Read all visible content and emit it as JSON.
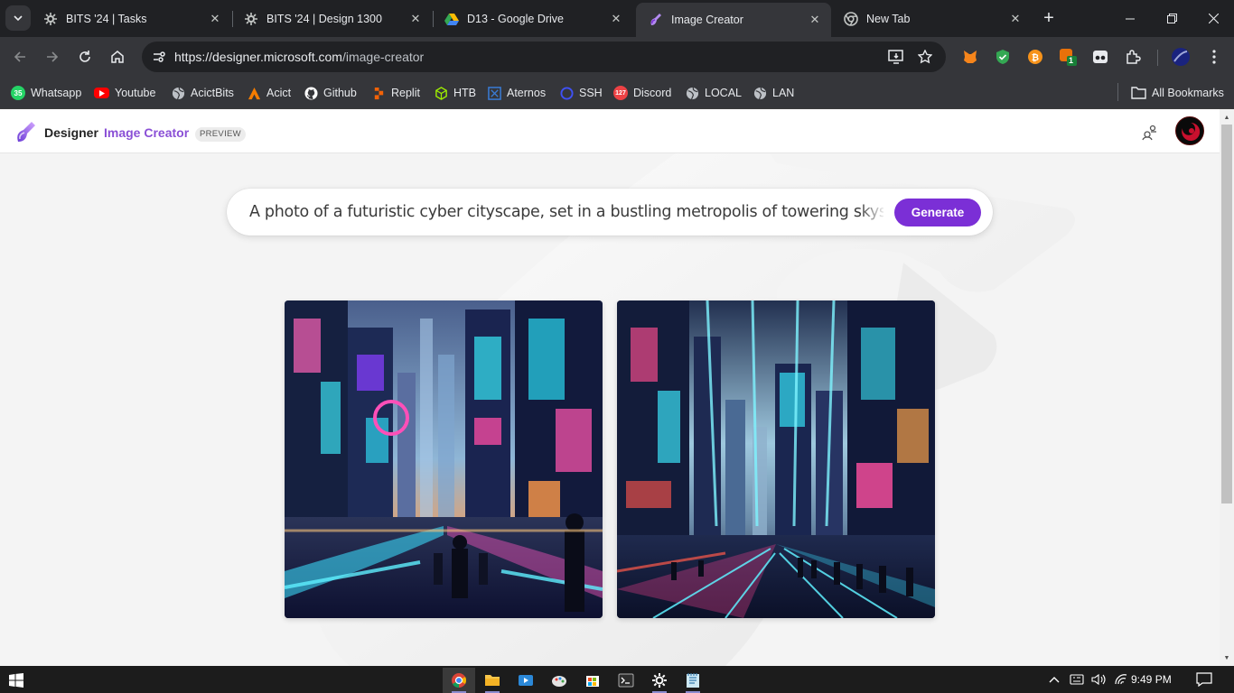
{
  "tabs": [
    {
      "title": "BITS '24 | Tasks",
      "icon": "gear-icon",
      "active": false
    },
    {
      "title": "BITS '24 | Design 1300",
      "icon": "gear-icon",
      "active": false
    },
    {
      "title": "D13 - Google Drive",
      "icon": "google-drive-icon",
      "active": false
    },
    {
      "title": "Image Creator",
      "icon": "designer-icon",
      "active": true
    },
    {
      "title": "New Tab",
      "icon": "chrome-icon",
      "active": false
    }
  ],
  "address_bar": {
    "host": "https://designer.microsoft.com",
    "path": "/image-creator"
  },
  "bookmarks": [
    {
      "label": "Whatsapp",
      "icon": "whatsapp-icon",
      "badge": "35",
      "color": "#25d366"
    },
    {
      "label": "Youtube",
      "icon": "youtube-icon",
      "color": "#ff0000"
    },
    {
      "label": "AcictBits",
      "icon": "globe-icon",
      "color": "#bdc1c6"
    },
    {
      "label": "Acict",
      "icon": "acict-icon",
      "color": "#f57c00"
    },
    {
      "label": "Github",
      "icon": "github-icon",
      "color": "#ffffff"
    },
    {
      "label": "Replit",
      "icon": "replit-icon",
      "color": "#f26207"
    },
    {
      "label": "HTB",
      "icon": "htb-cube-icon",
      "color": "#9fef00"
    },
    {
      "label": "Aternos",
      "icon": "aternos-icon",
      "color": "#3a7bd5"
    },
    {
      "label": "SSH",
      "icon": "ssh-icon",
      "color": "#3f51f5"
    },
    {
      "label": "Discord",
      "icon": "discord-icon",
      "badge": "127",
      "color": "#ed4245"
    },
    {
      "label": "LOCAL",
      "icon": "globe-icon",
      "color": "#bdc1c6"
    },
    {
      "label": "LAN",
      "icon": "globe-icon",
      "color": "#bdc1c6"
    }
  ],
  "all_bookmarks": "All Bookmarks",
  "app": {
    "brand": "Designer",
    "product": "Image Creator",
    "badge": "PREVIEW"
  },
  "prompt": {
    "text": "A photo of a futuristic cyber cityscape, set in a bustling metropolis of towering skyscrapers",
    "generate_label": "Generate"
  },
  "images": [
    {
      "name": "generated-image-1",
      "alt": "cyber city street with figures"
    },
    {
      "name": "generated-image-2",
      "alt": "cyber city avenue with light beams"
    }
  ],
  "extensions": {
    "badge_count": "1"
  },
  "taskbar": {
    "time": "9:49 PM"
  },
  "colors": {
    "accent": "#7b2fd6",
    "product_text": "#8a4fd6"
  }
}
